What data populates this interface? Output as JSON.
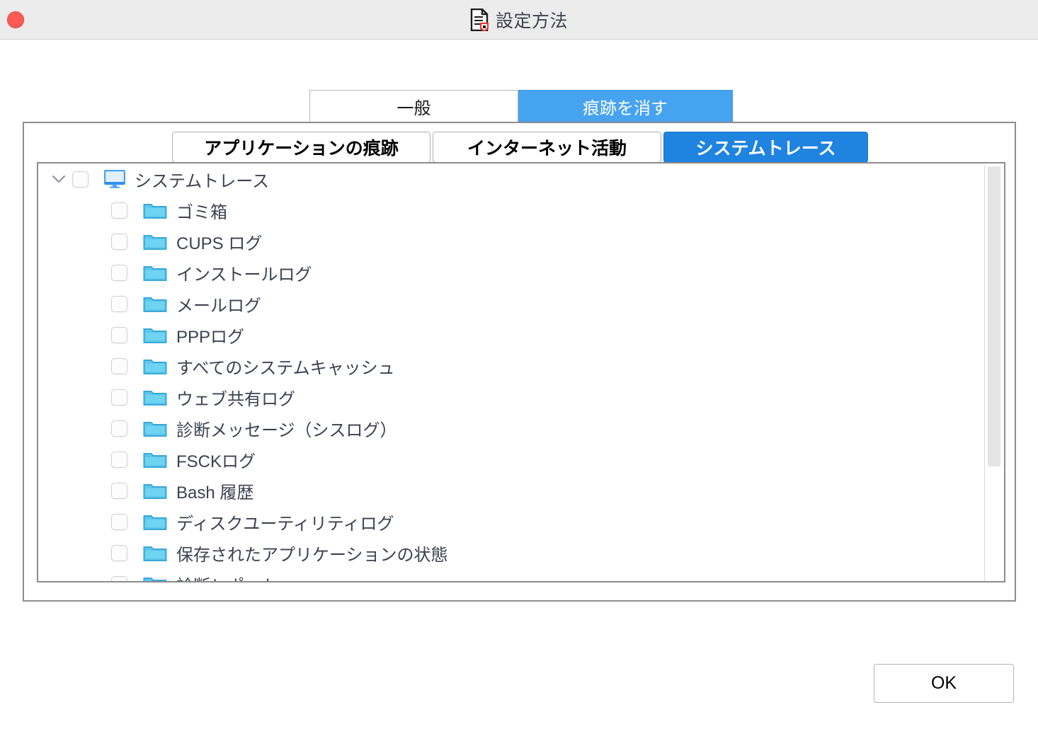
{
  "window": {
    "title": "設定方法",
    "close_button_label": "",
    "title_icon": "document-settings-icon"
  },
  "colors": {
    "titlebar_bg": "#ececec",
    "top_tab_active": "#46a3f0",
    "sub_tab_active": "#1f83e0",
    "folder_icon": "#5bc8ee",
    "monitor_icon": "#4da2f5",
    "close_dot": "#fc5b55",
    "text": "#3b4250",
    "panel_border": "#8c8c8c"
  },
  "top_tabs": [
    {
      "label": "一般",
      "active": false
    },
    {
      "label": "痕跡を消す",
      "active": true
    }
  ],
  "sub_tabs": [
    {
      "label": "アプリケーションの痕跡",
      "active": false
    },
    {
      "label": "インターネット活動",
      "active": false
    },
    {
      "label": "システムトレース",
      "active": true
    }
  ],
  "tree": {
    "root": {
      "label": "システムトレース",
      "icon": "monitor-icon",
      "checked": false,
      "expanded": true
    },
    "items": [
      {
        "label": "ゴミ箱",
        "icon": "folder-icon",
        "checked": false
      },
      {
        "label": "CUPS ログ",
        "icon": "folder-icon",
        "checked": false
      },
      {
        "label": "インストールログ",
        "icon": "folder-icon",
        "checked": false
      },
      {
        "label": "メールログ",
        "icon": "folder-icon",
        "checked": false
      },
      {
        "label": "PPPログ",
        "icon": "folder-icon",
        "checked": false
      },
      {
        "label": "すべてのシステムキャッシュ",
        "icon": "folder-icon",
        "checked": false
      },
      {
        "label": "ウェブ共有ログ",
        "icon": "folder-icon",
        "checked": false
      },
      {
        "label": "診断メッセージ（シスログ）",
        "icon": "folder-icon",
        "checked": false
      },
      {
        "label": "FSCKログ",
        "icon": "folder-icon",
        "checked": false
      },
      {
        "label": "Bash 履歴",
        "icon": "folder-icon",
        "checked": false
      },
      {
        "label": "ディスクユーティリティログ",
        "icon": "folder-icon",
        "checked": false
      },
      {
        "label": "保存されたアプリケーションの状態",
        "icon": "folder-icon",
        "checked": false
      },
      {
        "label": "診断レポート",
        "icon": "folder-icon",
        "checked": false
      }
    ]
  },
  "scrollbar": {
    "orientation": "vertical",
    "thumb_position_percent": 0,
    "thumb_size_percent": 72
  },
  "footer": {
    "ok_label": "OK"
  }
}
